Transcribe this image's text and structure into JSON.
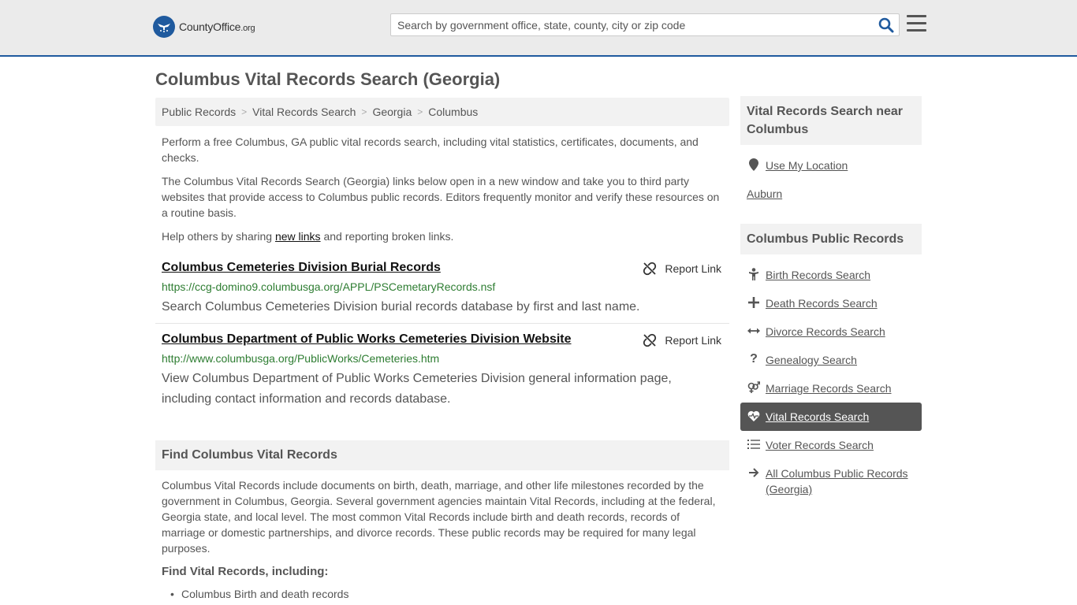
{
  "header": {
    "logo_main": "CountyOffice",
    "logo_suffix": ".org",
    "search_placeholder": "Search by government office, state, county, city or zip code"
  },
  "page_title": "Columbus Vital Records Search (Georgia)",
  "breadcrumb": [
    "Public Records",
    "Vital Records Search",
    "Georgia",
    "Columbus"
  ],
  "intro": {
    "p1": "Perform a free Columbus, GA public vital records search, including vital statistics, certificates, documents, and checks.",
    "p2": "The Columbus Vital Records Search (Georgia) links below open in a new window and take you to third party websites that provide access to Columbus public records. Editors frequently monitor and verify these resources on a routine basis.",
    "p3_before": "Help others by sharing ",
    "p3_link": "new links",
    "p3_after": " and reporting broken links."
  },
  "results": [
    {
      "title": "Columbus Cemeteries Division Burial Records",
      "report_label": "Report Link",
      "url": "https://ccg-domino9.columbusga.org/APPL/PSCemetaryRecords.nsf",
      "description": "Search Columbus Cemeteries Division burial records database by first and last name."
    },
    {
      "title": "Columbus Department of Public Works Cemeteries Division Website",
      "report_label": "Report Link",
      "url": "http://www.columbusga.org/PublicWorks/Cemeteries.htm",
      "description": "View Columbus Department of Public Works Cemeteries Division general information page, including contact information and records database."
    }
  ],
  "find_section": {
    "heading": "Find Columbus Vital Records",
    "body": "Columbus Vital Records include documents on birth, death, marriage, and other life milestones recorded by the government in Columbus, Georgia. Several government agencies maintain Vital Records, including at the federal, Georgia state, and local level. The most common Vital Records include birth and death records, records of marriage or domestic partnerships, and divorce records. These public records may be required for many legal purposes.",
    "subheading": "Find Vital Records, including:",
    "bullets": [
      "Columbus Birth and death records"
    ]
  },
  "sidebar": {
    "near_heading": "Vital Records Search near Columbus",
    "use_location": "Use My Location",
    "near_places": [
      "Auburn"
    ],
    "public_records_heading": "Columbus Public Records",
    "links": [
      {
        "label": "Birth Records Search",
        "icon": "child-icon",
        "active": false
      },
      {
        "label": "Death Records Search",
        "icon": "cross-icon",
        "active": false
      },
      {
        "label": "Divorce Records Search",
        "icon": "split-arrows-icon",
        "active": false
      },
      {
        "label": "Genealogy Search",
        "icon": "question-icon",
        "active": false
      },
      {
        "label": "Marriage Records Search",
        "icon": "venus-mars-icon",
        "active": false
      },
      {
        "label": "Vital Records Search",
        "icon": "heart-pulse-icon",
        "active": true
      },
      {
        "label": "Voter Records Search",
        "icon": "list-icon",
        "active": false
      },
      {
        "label": "All Columbus Public Records (Georgia)",
        "icon": "arrow-right-icon",
        "active": false
      }
    ]
  },
  "colors": {
    "brand_blue": "#1f5a9e",
    "url_green": "#2e7d32",
    "active_bg": "#555555"
  }
}
